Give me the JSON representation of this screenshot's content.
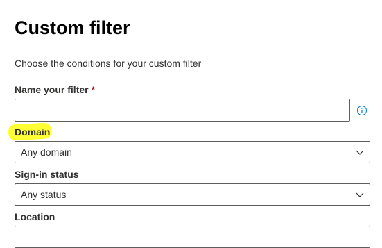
{
  "panel": {
    "title": "Custom filter",
    "description": "Choose the conditions for your custom filter"
  },
  "fields": {
    "name": {
      "label": "Name your filter",
      "required_marker": "*",
      "value": "",
      "info_icon": "info-icon"
    },
    "domain": {
      "label": "Domain",
      "selected": "Any domain",
      "highlighted": true
    },
    "signin_status": {
      "label": "Sign-in status",
      "selected": "Any status"
    },
    "location": {
      "label": "Location"
    }
  },
  "colors": {
    "accent": "#0078d4",
    "highlight": "#ffff33",
    "required": "#a4262c",
    "border": "#605e5c"
  }
}
